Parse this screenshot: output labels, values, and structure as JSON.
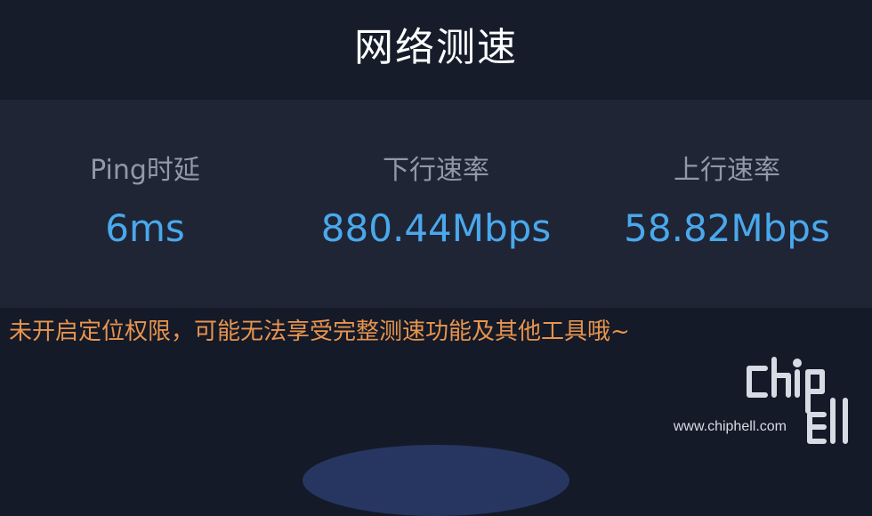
{
  "header": {
    "title": "网络测速"
  },
  "stats": [
    {
      "label": "Ping时延",
      "value": "6ms"
    },
    {
      "label": "下行速率",
      "value": "880.44Mbps"
    },
    {
      "label": "上行速率",
      "value": "58.82Mbps"
    }
  ],
  "notice": {
    "text": "未开启定位权限，可能无法享受完整测速功能及其他工具哦~"
  },
  "watermark": {
    "url": "www.chiphell.com"
  },
  "colors": {
    "background": "#141a28",
    "panel": "#1f2535",
    "accent_value": "#4aa8ec",
    "label": "#9198a6",
    "warning": "#e8944e"
  }
}
